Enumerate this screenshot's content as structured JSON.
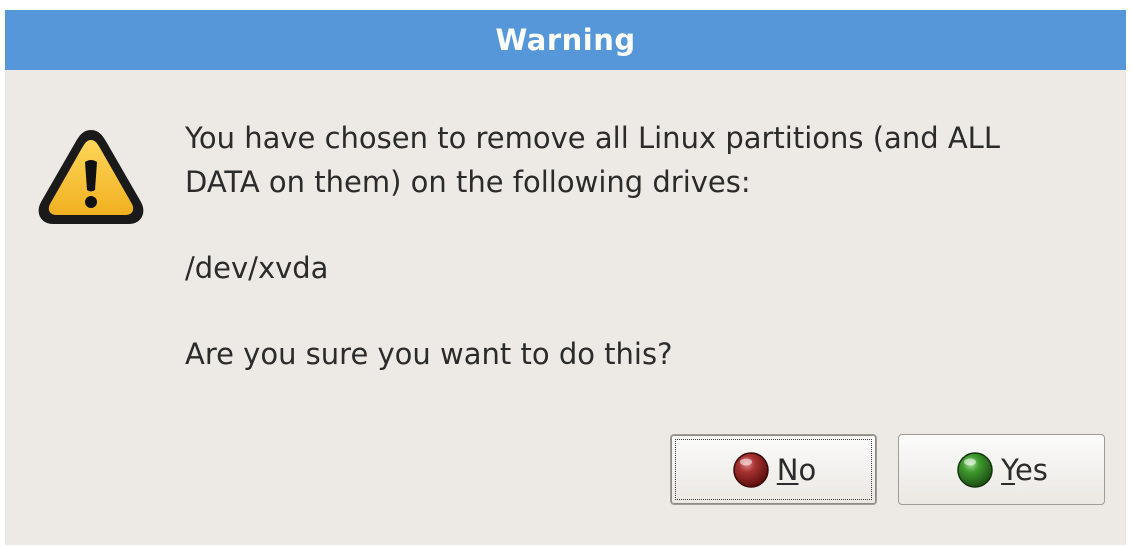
{
  "dialog": {
    "title": "Warning",
    "icon": "warning-icon",
    "message_line1": "You have chosen to remove all Linux partitions (and ALL",
    "message_line2": "DATA on them) on the following drives:",
    "drive": "/dev/xvda",
    "question": "Are you sure you want to do this?",
    "buttons": {
      "no": {
        "mnemonic": "N",
        "rest": "o",
        "icon": "red-circle-icon",
        "color": "#8b1a1a"
      },
      "yes": {
        "mnemonic": "Y",
        "rest": "es",
        "icon": "green-circle-icon",
        "color": "#2e7d1f"
      }
    }
  },
  "colors": {
    "titlebar": "#5597d8",
    "background": "#edeae5",
    "warning_yellow": "#f6c23a"
  }
}
